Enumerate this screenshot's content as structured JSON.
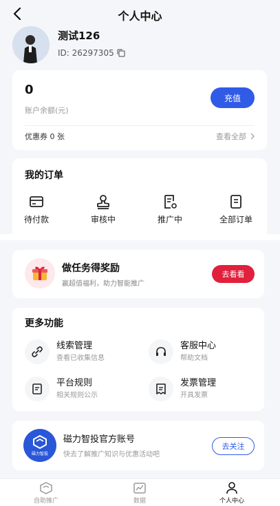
{
  "header": {
    "title": "个人中心"
  },
  "profile": {
    "name": "测试126",
    "id_text": "ID: 26297305"
  },
  "balance": {
    "value": "0",
    "label": "账户余额(元)",
    "recharge_label": "充值",
    "coupon_label": "优惠券 0 张",
    "view_all_label": "查看全部"
  },
  "orders": {
    "title": "我的订单",
    "items": [
      {
        "label": "待付款",
        "icon": "card-icon"
      },
      {
        "label": "审核中",
        "icon": "stamp-icon"
      },
      {
        "label": "推广中",
        "icon": "doc-edit-icon"
      },
      {
        "label": "全部订单",
        "icon": "doc-list-icon"
      }
    ]
  },
  "task": {
    "title": "做任务得奖励",
    "subtitle": "赢超值福利，助力智能推广",
    "button_label": "去看看",
    "colors": {
      "button": "#e0203c"
    }
  },
  "more": {
    "title": "更多功能",
    "items": [
      {
        "title": "线索管理",
        "subtitle": "查看已收集信息",
        "icon": "link-icon"
      },
      {
        "title": "客服中心",
        "subtitle": "帮助文档",
        "icon": "headset-icon"
      },
      {
        "title": "平台规则",
        "subtitle": "相关规则公示",
        "icon": "rules-doc-icon"
      },
      {
        "title": "发票管理",
        "subtitle": "开具发票",
        "icon": "invoice-icon"
      }
    ]
  },
  "official": {
    "logo_text": "磁力智投",
    "title": "磁力智投官方账号",
    "subtitle": "快去了解推广知识与优惠活动吧",
    "button_label": "去关注"
  },
  "tabbar": {
    "items": [
      {
        "label": "自助推广",
        "icon": "promote-icon",
        "active": false
      },
      {
        "label": "数据",
        "icon": "chart-icon",
        "active": false
      },
      {
        "label": "个人中心",
        "icon": "person-icon",
        "active": true
      }
    ]
  },
  "colors": {
    "accent": "#2f5be7",
    "background": "#f5f6fa"
  }
}
